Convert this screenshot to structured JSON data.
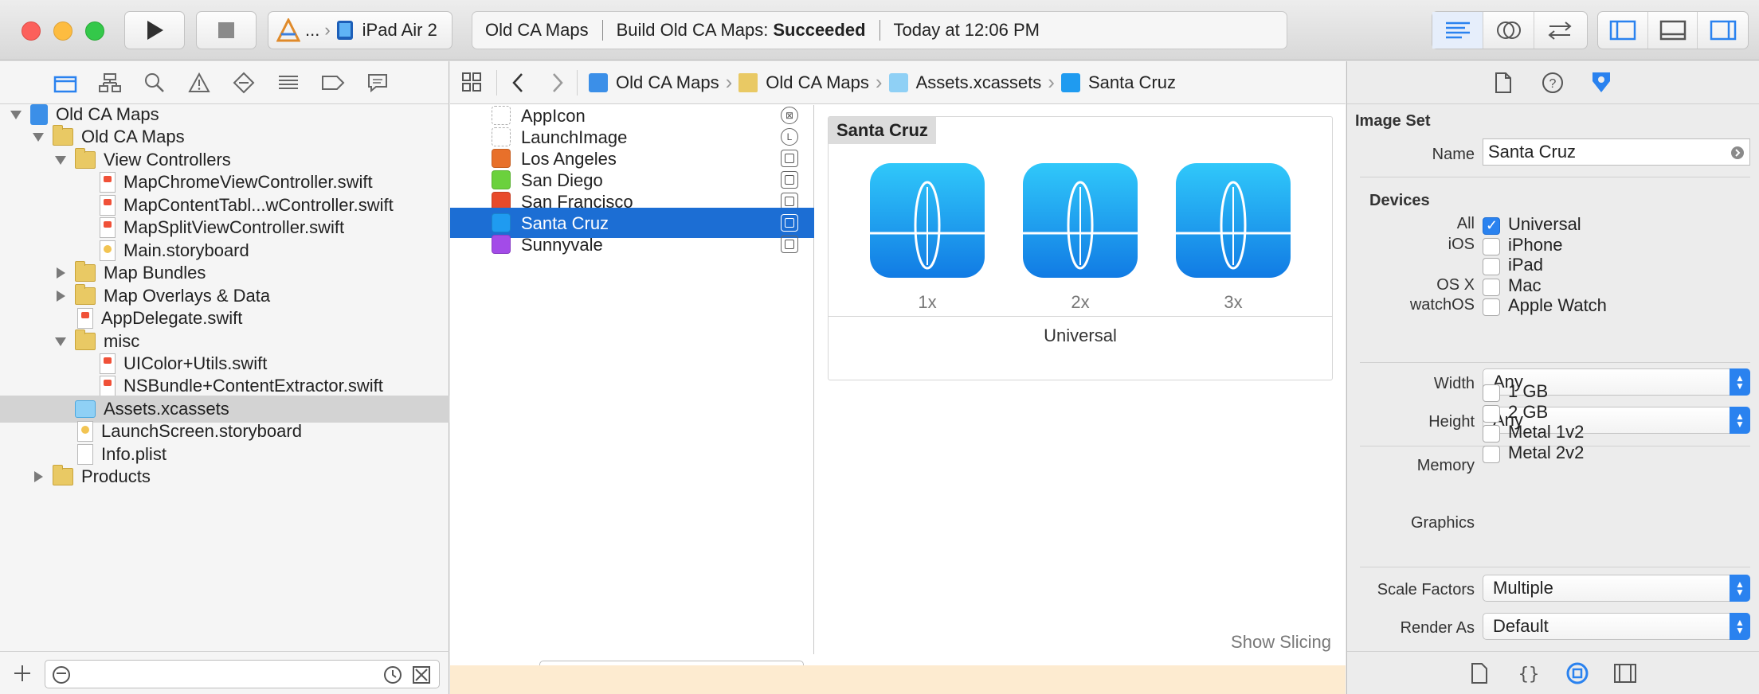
{
  "toolbar": {
    "scheme_ellipsis": "...",
    "device": "iPad Air 2",
    "status": {
      "project": "Old CA Maps",
      "build_prefix": "Build Old CA Maps:",
      "build_result": "Succeeded",
      "time": "Today at 12:06 PM"
    }
  },
  "navigator": {
    "tree": [
      {
        "label": "Old CA Maps",
        "depth": 0,
        "kind": "project",
        "disclosure": "open"
      },
      {
        "label": "Old CA Maps",
        "depth": 1,
        "kind": "folder",
        "disclosure": "open"
      },
      {
        "label": "View Controllers",
        "depth": 2,
        "kind": "folder",
        "disclosure": "open"
      },
      {
        "label": "MapChromeViewController.swift",
        "depth": 3,
        "kind": "swift"
      },
      {
        "label": "MapContentTabl...wController.swift",
        "depth": 3,
        "kind": "swift"
      },
      {
        "label": "MapSplitViewController.swift",
        "depth": 3,
        "kind": "swift"
      },
      {
        "label": "Main.storyboard",
        "depth": 3,
        "kind": "storyboard"
      },
      {
        "label": "Map Bundles",
        "depth": 2,
        "kind": "folder",
        "disclosure": "closed"
      },
      {
        "label": "Map Overlays & Data",
        "depth": 2,
        "kind": "folder",
        "disclosure": "closed"
      },
      {
        "label": "AppDelegate.swift",
        "depth": 2,
        "kind": "swift"
      },
      {
        "label": "misc",
        "depth": 2,
        "kind": "folder",
        "disclosure": "open"
      },
      {
        "label": "UIColor+Utils.swift",
        "depth": 3,
        "kind": "swift"
      },
      {
        "label": "NSBundle+ContentExtractor.swift",
        "depth": 3,
        "kind": "swift"
      },
      {
        "label": "Assets.xcassets",
        "depth": 2,
        "kind": "xcassets",
        "selected": true
      },
      {
        "label": "LaunchScreen.storyboard",
        "depth": 2,
        "kind": "storyboard"
      },
      {
        "label": "Info.plist",
        "depth": 2,
        "kind": "plist"
      },
      {
        "label": "Products",
        "depth": 1,
        "kind": "folder",
        "disclosure": "closed"
      }
    ]
  },
  "jumpbar": {
    "crumbs": [
      "Old CA Maps",
      "Old CA Maps",
      "Assets.xcassets",
      "Santa Cruz"
    ]
  },
  "assets": {
    "items": [
      {
        "label": "AppIcon",
        "icon_color": "none",
        "badge": "⊠"
      },
      {
        "label": "LaunchImage",
        "icon_color": "none",
        "badge": "L"
      },
      {
        "label": "Los Angeles",
        "icon_color": "#e8702a",
        "badge": ""
      },
      {
        "label": "San Diego",
        "icon_color": "#6bd13d",
        "badge": ""
      },
      {
        "label": "San Francisco",
        "icon_color": "#e84a2a",
        "badge": ""
      },
      {
        "label": "Santa Cruz",
        "icon_color": "#1f9bf0",
        "badge": "",
        "selected": true
      },
      {
        "label": "Sunnyvale",
        "icon_color": "#a34be8",
        "badge": ""
      }
    ]
  },
  "canvas": {
    "title": "Santa Cruz",
    "slots": [
      "1x",
      "2x",
      "3x"
    ],
    "group_label": "Universal",
    "show_slicing": "Show Slicing"
  },
  "inspector": {
    "section_title": "Image Set",
    "name_label": "Name",
    "name_value": "Santa Cruz",
    "devices_title": "Devices",
    "devices": [
      {
        "group": "All",
        "label": "Universal",
        "checked": true
      },
      {
        "group": "iOS",
        "label": "iPhone",
        "checked": false
      },
      {
        "group": "",
        "label": "iPad",
        "checked": false
      },
      {
        "group": "OS X",
        "label": "Mac",
        "checked": false
      },
      {
        "group": "watchOS",
        "label": "Apple Watch",
        "checked": false
      }
    ],
    "width_label": "Width",
    "width_value": "Any",
    "height_label": "Height",
    "height_value": "Any",
    "memory_label": "Memory",
    "memory": [
      {
        "label": "1 GB",
        "checked": false
      },
      {
        "label": "2 GB",
        "checked": false
      }
    ],
    "graphics_label": "Graphics",
    "graphics": [
      {
        "label": "Metal 1v2",
        "checked": false
      },
      {
        "label": "Metal 2v2",
        "checked": false
      }
    ],
    "scale_label": "Scale Factors",
    "scale_value": "Multiple",
    "render_label": "Render As",
    "render_value": "Default"
  },
  "colors": {
    "accent": "#2a82ef",
    "selection": "#1c6ed4",
    "light_close": "#fc605b",
    "light_min": "#fdbc40",
    "light_max": "#34c84a"
  }
}
